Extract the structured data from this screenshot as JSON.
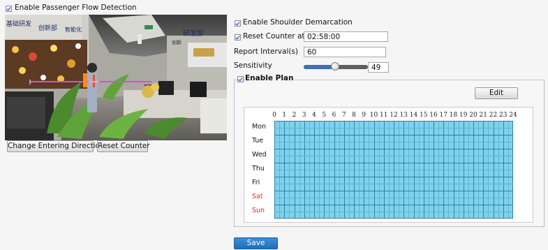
{
  "enable_detection": {
    "label": "Enable Passenger Flow Detection",
    "checked": true
  },
  "camera_buttons": {
    "change_direction": "Change Entering Direction",
    "reset_counter": "Reset Counter"
  },
  "camera_signs": {
    "sign1": "基础研发",
    "sign2": "创新部",
    "sign3": "智能化",
    "sign4": "研发部",
    "sign5": "创新"
  },
  "settings": {
    "shoulder": {
      "label": "Enable Shoulder Demarcation",
      "checked": true
    },
    "reset_at": {
      "label": "Reset Counter at",
      "checked": true,
      "value": "02:58:00"
    },
    "report_interval": {
      "label": "Report Interval(s)",
      "value": "60"
    },
    "sensitivity": {
      "label": "Sensitivity",
      "value": "49",
      "max": 100
    }
  },
  "plan": {
    "label": "Enable Plan",
    "checked": true,
    "edit_label": "Edit",
    "hours": [
      "0",
      "1",
      "2",
      "3",
      "4",
      "5",
      "6",
      "7",
      "8",
      "9",
      "10",
      "11",
      "12",
      "13",
      "14",
      "15",
      "16",
      "17",
      "18",
      "19",
      "20",
      "21",
      "22",
      "23",
      "24"
    ],
    "days": [
      "Mon",
      "Tue",
      "Wed",
      "Thu",
      "Fri",
      "Sat",
      "Sun"
    ],
    "weekend_color": "#e8251c",
    "fill_color": "#7fd2ec"
  },
  "save_label": "Save"
}
